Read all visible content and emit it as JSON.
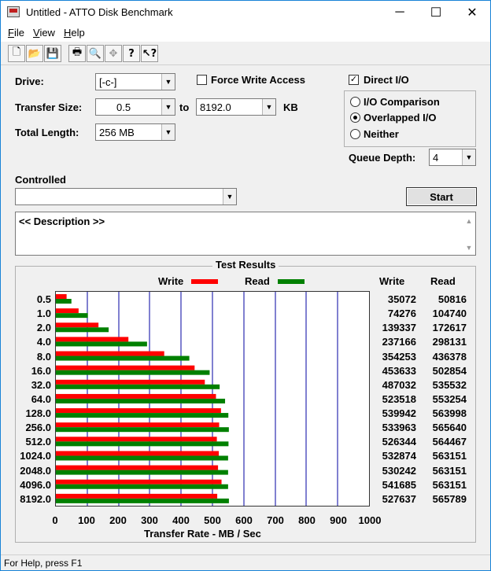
{
  "window": {
    "title": "Untitled - ATTO Disk Benchmark",
    "minimize": "─",
    "maximize": "☐",
    "close": "✕"
  },
  "menu": [
    {
      "label": "File",
      "accel": "F",
      "rest": "ile"
    },
    {
      "label": "View",
      "accel": "V",
      "rest": "iew"
    },
    {
      "label": "Help",
      "accel": "H",
      "rest": "elp"
    }
  ],
  "toolbar": {
    "icons": [
      "new-document-icon",
      "open-folder-icon",
      "save-icon",
      "print-icon",
      "print-preview-icon",
      "move-icon",
      "help-icon",
      "context-help-icon"
    ],
    "glyphs": [
      "🗋",
      "📂",
      "💾",
      "🖶",
      "🔍",
      "✥",
      "?",
      "↖?"
    ]
  },
  "form": {
    "drive_label": "Drive:",
    "drive_value": "[-c-]",
    "force_write_label": "Force Write Access",
    "force_write_checked": false,
    "direct_io_label": "Direct I/O",
    "direct_io_checked": true,
    "transfer_size_label": "Transfer Size:",
    "transfer_from": "0.5",
    "to_label": "to",
    "transfer_to": "8192.0",
    "kb_label": "KB",
    "total_length_label": "Total Length:",
    "total_length_value": "256 MB",
    "radio_io_comparison": "I/O Comparison",
    "radio_overlapped": "Overlapped I/O",
    "radio_neither": "Neither",
    "selected_mode": "Overlapped I/O",
    "queue_depth_label": "Queue Depth:",
    "queue_depth_value": "4",
    "controlled_label": "Controlled",
    "controlled_value": "",
    "start_label": "Start",
    "description": "<< Description >>"
  },
  "results": {
    "title": "Test Results",
    "legend_write": "Write",
    "legend_read": "Read",
    "col_write": "Write",
    "col_read": "Read",
    "write_color": "#ff0000",
    "read_color": "#008000",
    "xlabel": "Transfer Rate - MB / Sec"
  },
  "chart_data": {
    "type": "bar",
    "orientation": "horizontal",
    "title": "Test Results",
    "xlabel": "Transfer Rate - MB / Sec",
    "xlim": [
      0,
      1000
    ],
    "xticks": [
      "0",
      "100",
      "200",
      "300",
      "400",
      "500",
      "600",
      "700",
      "800",
      "900",
      "1000"
    ],
    "categories": [
      "0.5",
      "1.0",
      "2.0",
      "4.0",
      "8.0",
      "16.0",
      "32.0",
      "64.0",
      "128.0",
      "256.0",
      "512.0",
      "1024.0",
      "2048.0",
      "4096.0",
      "8192.0"
    ],
    "series": [
      {
        "name": "Write",
        "values": [
          35072,
          74276,
          139337,
          237166,
          354253,
          453633,
          487032,
          523518,
          539942,
          533963,
          526344,
          532874,
          530242,
          541685,
          527637
        ]
      },
      {
        "name": "Read",
        "values": [
          50816,
          104740,
          172617,
          298131,
          436378,
          502854,
          535532,
          553254,
          563998,
          565640,
          564467,
          563151,
          563151,
          563151,
          565789
        ]
      }
    ],
    "grid": true,
    "legend": "top"
  },
  "status": "For Help, press F1"
}
